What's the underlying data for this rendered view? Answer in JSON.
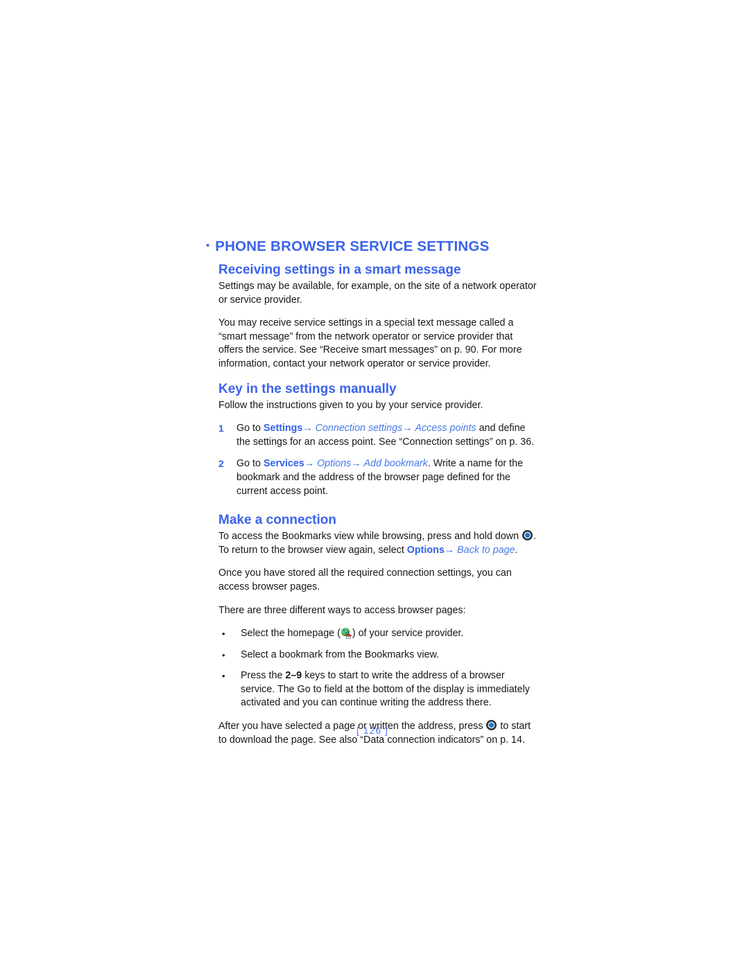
{
  "document": {
    "page_number": "[ 126 ]",
    "accent_color": "#3b63ea",
    "body_color": "#161616"
  },
  "section": {
    "heading": "PHONE BROWSER SERVICE SETTINGS",
    "bullet_glyph": "•"
  },
  "subsections": {
    "receiving": {
      "heading": "Receiving settings in a smart message",
      "paragraph_1": "Settings may be available, for example, on the site of a network operator or service provider.",
      "paragraph_2": "You may receive service settings in a special text message called a “smart message” from the network operator or service provider that offers the service. See “Receive smart messages” on p. 90. For more information, contact your network operator or service provider."
    },
    "key_in": {
      "heading": "Key in the settings manually",
      "intro": "Follow the instructions given to you by your service provider.",
      "steps": [
        {
          "marker": "1",
          "lead": "Go to ",
          "term_1": "Settings",
          "arrow_1": "→",
          "term_2": "Connection settings",
          "arrow_2": "→",
          "term_3": "Access points",
          "tail": " and define the settings for an access point. See “Connection settings” on p. 36."
        },
        {
          "marker": "2",
          "lead": "Go to ",
          "term_1": "Services",
          "arrow_1": "→",
          "term_2": "Options",
          "arrow_2": "→",
          "term_3": "Add bookmark",
          "tail": ". Write a name for the bookmark and the address of the browser page defined for the current access point."
        }
      ]
    },
    "make_connection": {
      "heading": "Make a connection",
      "line_1_before": "To access the Bookmarks view while browsing, press and hold down ",
      "line_1_after": ".",
      "line_2_before": "To return to the browser view again, select ",
      "line_2_term_1": "Options",
      "line_2_arrow": "→",
      "line_2_term_2": "Back to page",
      "line_2_after": ".",
      "paragraph_1": "Once you have stored all the required connection settings, you can access browser pages.",
      "paragraph_2": "There are three different ways to access browser pages:",
      "bullets": [
        {
          "marker": "•",
          "before": "Select the homepage (",
          "after": ") of your service provider."
        },
        {
          "marker": "•",
          "text": "Select a bookmark from the Bookmarks view."
        },
        {
          "marker": "•",
          "before": "Press the ",
          "keys": "2–9",
          "after": " keys to start to write the address of a browser service. The Go to field at the bottom of the display is immediately activated and you can continue writing the address there."
        }
      ],
      "closing_before": "After you have selected a page or written the address, press ",
      "closing_after": " to start to download the page. See also “Data connection indicators” on p. 14."
    }
  },
  "icons": {
    "joystick": "joystick-icon",
    "homepage": "homepage-globe-house-icon"
  }
}
